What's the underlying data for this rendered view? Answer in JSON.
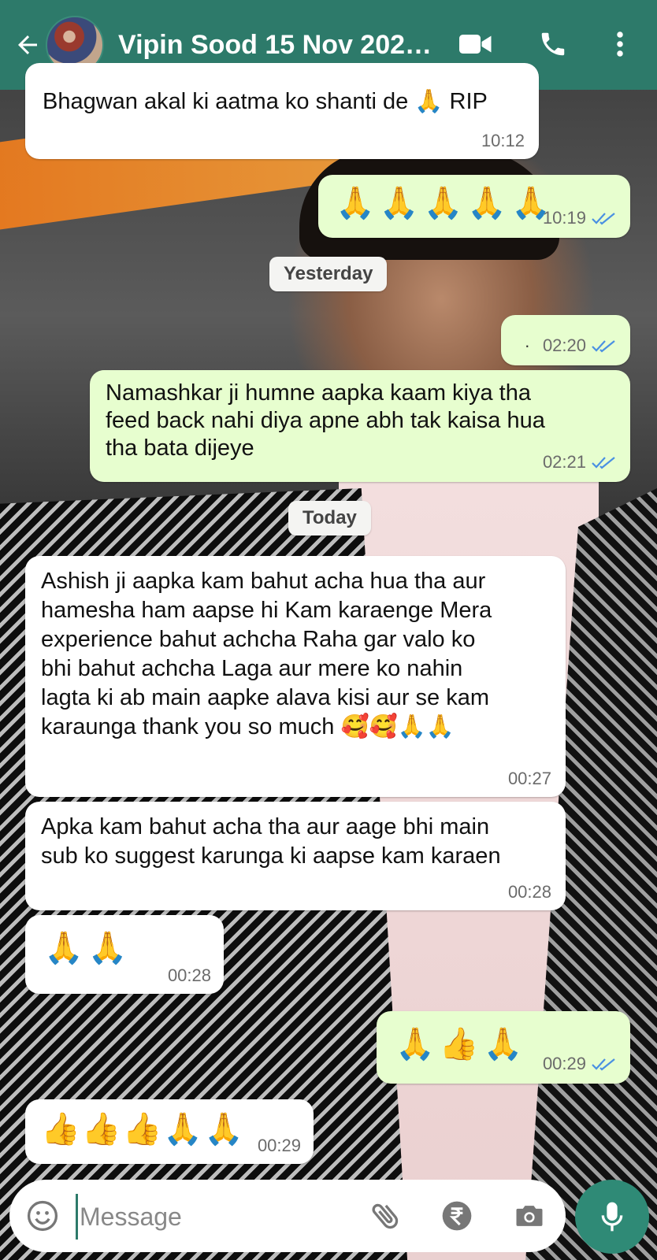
{
  "header": {
    "title": "Vipin Sood 15 Nov 202…",
    "colors": {
      "header_bg": "#2d7a6a",
      "incoming_bubble": "#ffffff",
      "outgoing_bubble": "#e7fecf",
      "tick_blue": "#4a90e2"
    }
  },
  "messages": [
    {
      "direction": "in",
      "text": "Bhagwan akal ki aatma ko shanti de 🙏 RIP",
      "time": "10:12"
    },
    {
      "direction": "out",
      "text": "🙏🙏🙏🙏🙏",
      "time": "10:19",
      "read": true
    },
    {
      "direction": "out",
      "text": "·",
      "time": "02:20",
      "read": true
    },
    {
      "direction": "out",
      "text": "Namashkar ji humne aapka kaam kiya tha\nfeed back nahi diya apne abh tak kaisa hua\ntha bata dijeye",
      "time": "02:21",
      "read": true
    },
    {
      "direction": "in",
      "text": "Ashish ji aapka kam bahut acha hua tha aur\nhamesha ham aapse hi Kam karaenge Mera\nexperience bahut achcha Raha gar valo ko\nbhi bahut achcha Laga aur mere ko nahin\nlagta ki ab main aapke alava kisi aur se kam\nkaraunga thank you so much 🥰🥰🙏🙏",
      "time": "00:27"
    },
    {
      "direction": "in",
      "text": "Apka kam bahut acha tha aur aage bhi main\nsub ko suggest karunga ki aapse kam karaen",
      "time": "00:28"
    },
    {
      "direction": "in",
      "text": "🙏🙏",
      "time": "00:28"
    },
    {
      "direction": "out",
      "text": "🙏👍🙏",
      "time": "00:29",
      "read": true
    },
    {
      "direction": "in",
      "text": "👍👍👍🙏🙏",
      "time": "00:29"
    }
  ],
  "date_separators": [
    "Yesterday",
    "Today"
  ],
  "composer": {
    "placeholder": "Message"
  },
  "icons": [
    "back-arrow-icon",
    "video-call-icon",
    "phone-icon",
    "more-options-icon",
    "smiley-icon",
    "attachment-icon",
    "rupee-icon",
    "camera-icon",
    "microphone-icon"
  ]
}
